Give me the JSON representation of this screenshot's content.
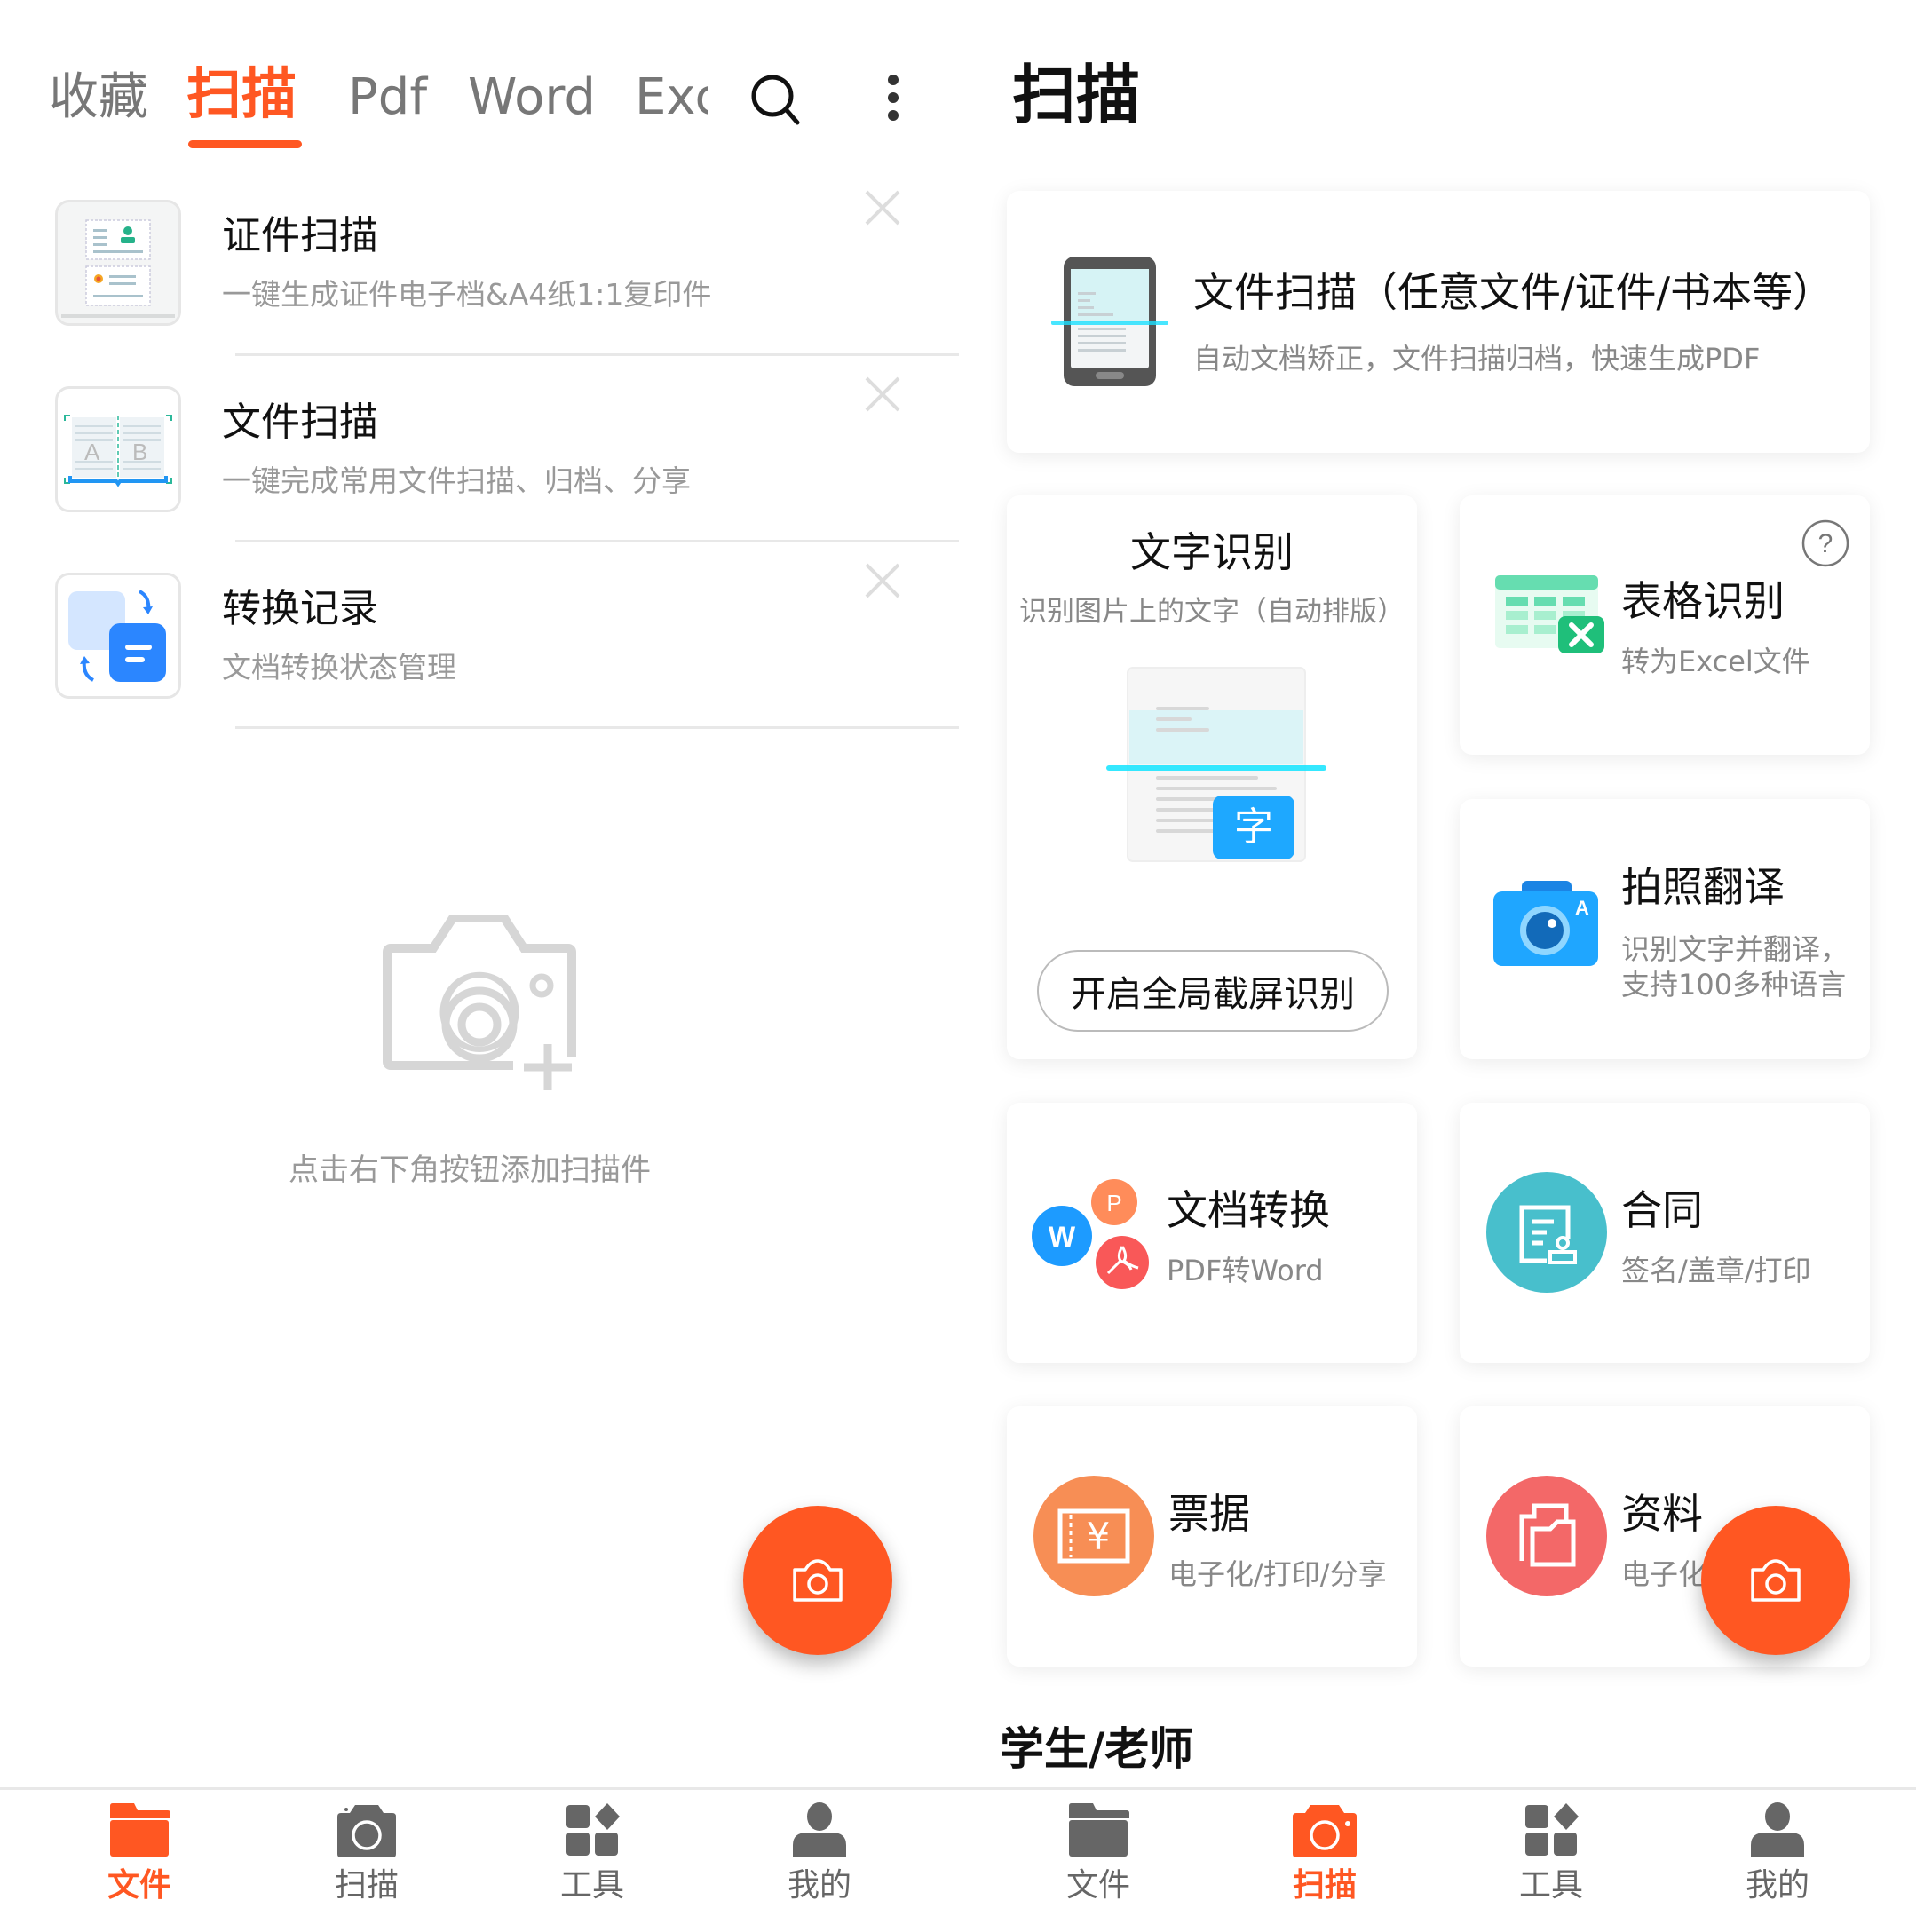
{
  "colors": {
    "accent": "#ff5722",
    "text_primary": "#111111",
    "text_secondary": "#999999",
    "icon_gray": "#666666"
  },
  "left_panel": {
    "tabs": [
      {
        "label": "收藏",
        "active": false
      },
      {
        "label": "扫描",
        "active": true
      },
      {
        "label": "Pdf",
        "active": false
      },
      {
        "label": "Word",
        "active": false
      },
      {
        "label": "Exc",
        "active": false
      }
    ],
    "search_icon": "search-icon",
    "more_icon": "more-vertical-icon",
    "list": [
      {
        "title": "证件扫描",
        "subtitle": "一键生成证件电子档&A4纸1:1复印件",
        "icon": "id-card-scan-icon"
      },
      {
        "title": "文件扫描",
        "subtitle": "一键完成常用文件扫描、归档、分享",
        "icon": "book-scan-icon"
      },
      {
        "title": "转换记录",
        "subtitle": "文档转换状态管理",
        "icon": "convert-record-icon"
      }
    ],
    "empty_state": {
      "icon": "add-camera-icon",
      "text": "点击右下角按钮添加扫描件"
    },
    "fab_icon": "camera-icon",
    "bottom_nav": [
      {
        "label": "文件",
        "icon": "folder-icon",
        "active": true
      },
      {
        "label": "扫描",
        "icon": "camera-icon",
        "active": false
      },
      {
        "label": "工具",
        "icon": "tools-icon",
        "active": false
      },
      {
        "label": "我的",
        "icon": "user-icon",
        "active": false
      }
    ]
  },
  "right_panel": {
    "title": "扫描",
    "main_card": {
      "title": "文件扫描（任意文件/证件/书本等）",
      "subtitle": "自动文档矫正，文件扫描归档，快速生成PDF"
    },
    "ocr_card": {
      "title": "文字识别",
      "subtitle": "识别图片上的文字（自动排版）",
      "badge": "字",
      "button": "开启全局截屏识别"
    },
    "cards": [
      {
        "title": "表格识别",
        "subtitle": "转为Excel文件",
        "help": "?"
      },
      {
        "title": "拍照翻译",
        "subtitle_lines": [
          "识别文字并翻译，",
          "支持100多种语言"
        ],
        "badge": "A"
      },
      {
        "title": "文档转换",
        "subtitle": "PDF转Word",
        "letters": [
          "W",
          "P"
        ]
      },
      {
        "title": "合同",
        "subtitle": "签名/盖章/打印"
      },
      {
        "title": "票据",
        "subtitle": "电子化/打印/分享",
        "symbol": "¥"
      },
      {
        "title": "资料",
        "subtitle": "电子化"
      }
    ],
    "section_title": "学生/老师",
    "bottom_nav": [
      {
        "label": "文件",
        "icon": "folder-icon",
        "active": false
      },
      {
        "label": "扫描",
        "icon": "camera-icon",
        "active": true
      },
      {
        "label": "工具",
        "icon": "tools-icon",
        "active": false
      },
      {
        "label": "我的",
        "icon": "user-icon",
        "active": false
      }
    ]
  }
}
